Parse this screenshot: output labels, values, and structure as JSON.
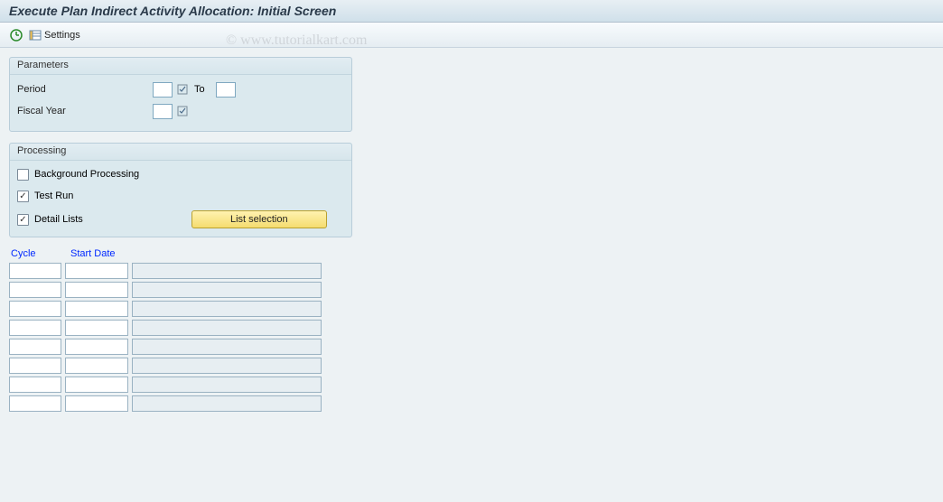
{
  "title": "Execute Plan Indirect Activity Allocation: Initial Screen",
  "toolbar": {
    "settings_label": "Settings"
  },
  "watermark": "© www.tutorialkart.com",
  "parameters": {
    "title": "Parameters",
    "period_label": "Period",
    "period_from": "",
    "to_label": "To",
    "period_to": "",
    "fiscal_year_label": "Fiscal Year",
    "fiscal_year": ""
  },
  "processing": {
    "title": "Processing",
    "bg_label": "Background Processing",
    "bg_checked": false,
    "test_label": "Test Run",
    "test_checked": true,
    "detail_label": "Detail Lists",
    "detail_checked": true,
    "list_selection_label": "List selection"
  },
  "table": {
    "cycle_header": "Cycle",
    "start_header": "Start Date",
    "rows": [
      {
        "cycle": "",
        "start": "",
        "desc": ""
      },
      {
        "cycle": "",
        "start": "",
        "desc": ""
      },
      {
        "cycle": "",
        "start": "",
        "desc": ""
      },
      {
        "cycle": "",
        "start": "",
        "desc": ""
      },
      {
        "cycle": "",
        "start": "",
        "desc": ""
      },
      {
        "cycle": "",
        "start": "",
        "desc": ""
      },
      {
        "cycle": "",
        "start": "",
        "desc": ""
      },
      {
        "cycle": "",
        "start": "",
        "desc": ""
      }
    ]
  }
}
